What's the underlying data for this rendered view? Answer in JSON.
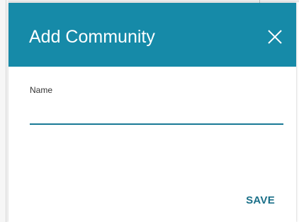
{
  "dialog": {
    "title": "Add Community",
    "close_icon": "close-icon",
    "fields": {
      "name": {
        "label": "Name",
        "value": "",
        "placeholder": ""
      }
    },
    "actions": {
      "save_label": "SAVE"
    }
  },
  "colors": {
    "header_background": "#168aa8",
    "header_text": "#ffffff",
    "input_underline": "#1a7a96",
    "save_text": "#1a6f88",
    "label_text": "#333333"
  }
}
